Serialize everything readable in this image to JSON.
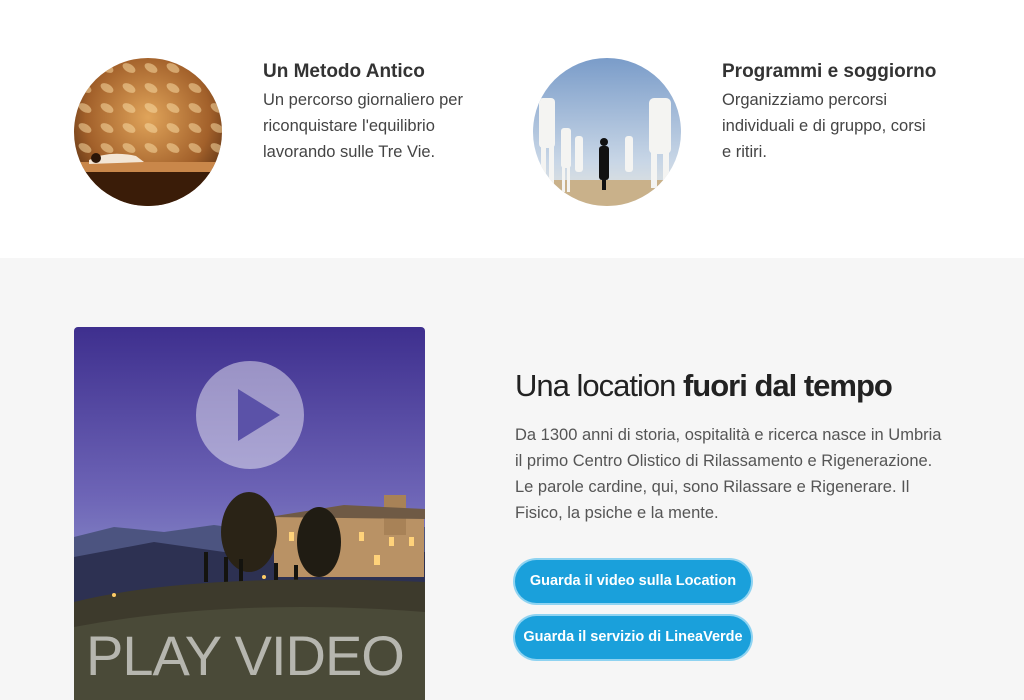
{
  "features": [
    {
      "title": "Un Metodo Antico",
      "lines": [
        "Un percorso giornaliero per",
        "riconquistare l'equilibrio",
        "lavorando sulle Tre Vie."
      ]
    },
    {
      "title": "Programmi e soggiorno",
      "lines": [
        "Organizziamo percorsi",
        "individuali e di gruppo, corsi",
        "e ritiri."
      ]
    }
  ],
  "location": {
    "title_light": "Una location ",
    "title_bold": "fuori dal tempo",
    "description": "Da 1300 anni di storia, ospitalità e ricerca nasce in Umbria il primo Centro Olistico di Rilassamento e Rigenerazione. Le parole cardine, qui, sono Rilassare e Rigenerare. Il Fisico, la psiche e la mente."
  },
  "video": {
    "label": "PLAY VIDEO",
    "icon": "play-icon"
  },
  "buttons": {
    "video": "Guarda il video sulla Location",
    "service": "Guarda il servizio di LineaVerde"
  },
  "colors": {
    "button": "#1aa0db",
    "section_bg": "#f6f6f6"
  }
}
